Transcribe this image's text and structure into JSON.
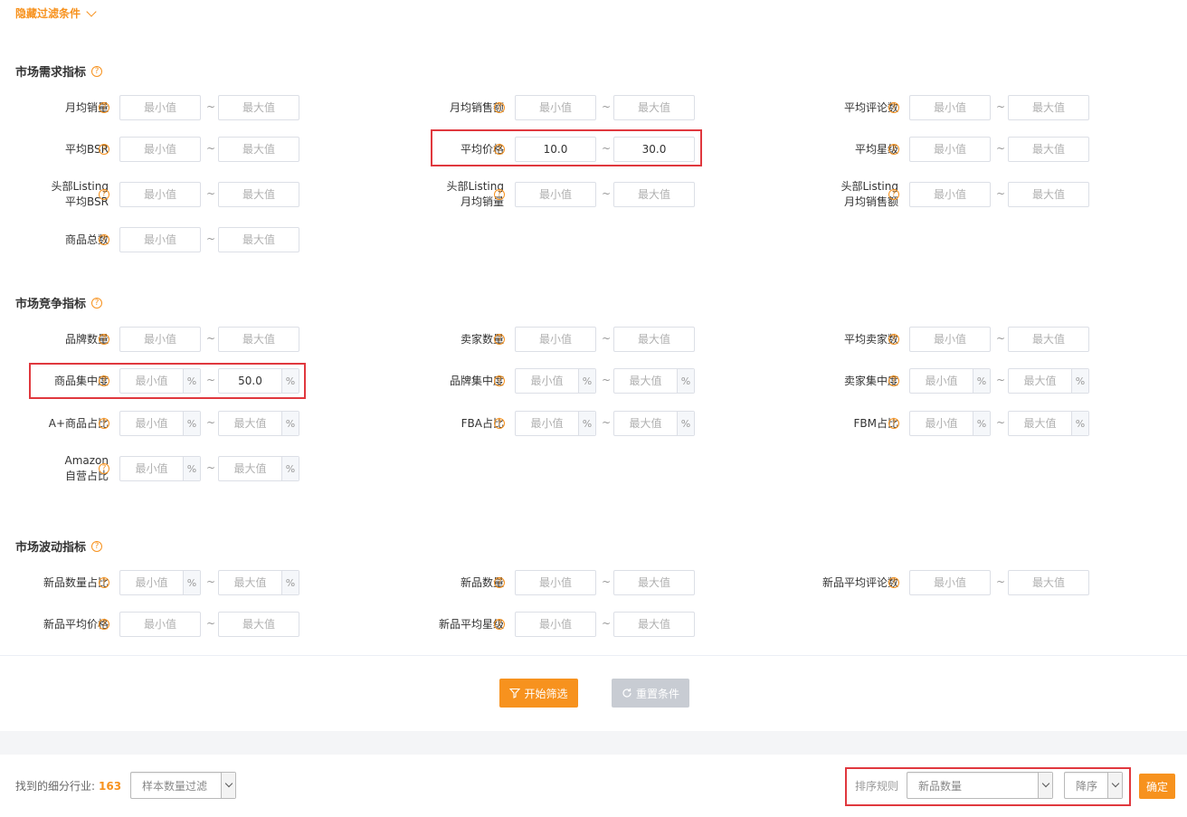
{
  "toggle": {
    "label": "隐藏过滤条件"
  },
  "help_glyph": "?",
  "tilde": "~",
  "pct": "%",
  "sections": {
    "demand": {
      "title": "市场需求指标",
      "fields": {
        "monthly_sales": {
          "label": "月均销量",
          "min": "",
          "max": ""
        },
        "monthly_revenue": {
          "label": "月均销售额",
          "min": "",
          "max": ""
        },
        "avg_reviews": {
          "label": "平均评论数",
          "min": "",
          "max": ""
        },
        "avg_bsr": {
          "label": "平均BSR",
          "min": "",
          "max": ""
        },
        "avg_price": {
          "label": "平均价格",
          "min": "10.0",
          "max": "30.0"
        },
        "avg_rating": {
          "label": "平均星级",
          "min": "",
          "max": ""
        },
        "top_bsr": {
          "label_l1": "头部Listing",
          "label_l2": "平均BSR",
          "min": "",
          "max": ""
        },
        "top_sales": {
          "label_l1": "头部Listing",
          "label_l2": "月均销量",
          "min": "",
          "max": ""
        },
        "top_revenue": {
          "label_l1": "头部Listing",
          "label_l2": "月均销售额",
          "min": "",
          "max": ""
        },
        "total_products": {
          "label": "商品总数",
          "min": "",
          "max": ""
        }
      }
    },
    "competition": {
      "title": "市场竞争指标",
      "fields": {
        "brand_count": {
          "label": "品牌数量",
          "min": "",
          "max": ""
        },
        "seller_count": {
          "label": "卖家数量",
          "min": "",
          "max": ""
        },
        "avg_sellers": {
          "label": "平均卖家数",
          "min": "",
          "max": ""
        },
        "product_conc": {
          "label": "商品集中度",
          "min": "",
          "max": "50.0"
        },
        "brand_conc": {
          "label": "品牌集中度",
          "min": "",
          "max": ""
        },
        "seller_conc": {
          "label": "卖家集中度",
          "min": "",
          "max": ""
        },
        "aplus_ratio": {
          "label": "A+商品占比",
          "min": "",
          "max": ""
        },
        "fba_ratio": {
          "label": "FBA占比",
          "min": "",
          "max": ""
        },
        "fbm_ratio": {
          "label": "FBM占比",
          "min": "",
          "max": ""
        },
        "amazon_ratio": {
          "label_l1": "Amazon",
          "label_l2": "自营占比",
          "min": "",
          "max": ""
        }
      }
    },
    "volatility": {
      "title": "市场波动指标",
      "fields": {
        "new_ratio": {
          "label": "新品数量占比",
          "min": "",
          "max": ""
        },
        "new_count": {
          "label": "新品数量",
          "min": "",
          "max": ""
        },
        "new_avg_reviews": {
          "label": "新品平均评论数",
          "min": "",
          "max": ""
        },
        "new_avg_price": {
          "label": "新品平均价格",
          "min": "",
          "max": ""
        },
        "new_avg_rating": {
          "label": "新品平均星级",
          "min": "",
          "max": ""
        }
      }
    }
  },
  "placeholders": {
    "min": "最小值",
    "max": "最大值"
  },
  "actions": {
    "start": "开始筛选",
    "reset": "重置条件"
  },
  "footer": {
    "found_label": "找到的细分行业:",
    "found_count": "163",
    "sample_filter": "样本数量过滤",
    "sort_label": "排序规则",
    "sort_field": "新品数量",
    "sort_order": "降序",
    "confirm": "确定"
  },
  "colors": {
    "accent": "#f7921e",
    "highlight": "#e0383e",
    "disabled": "#c8ccd3"
  }
}
